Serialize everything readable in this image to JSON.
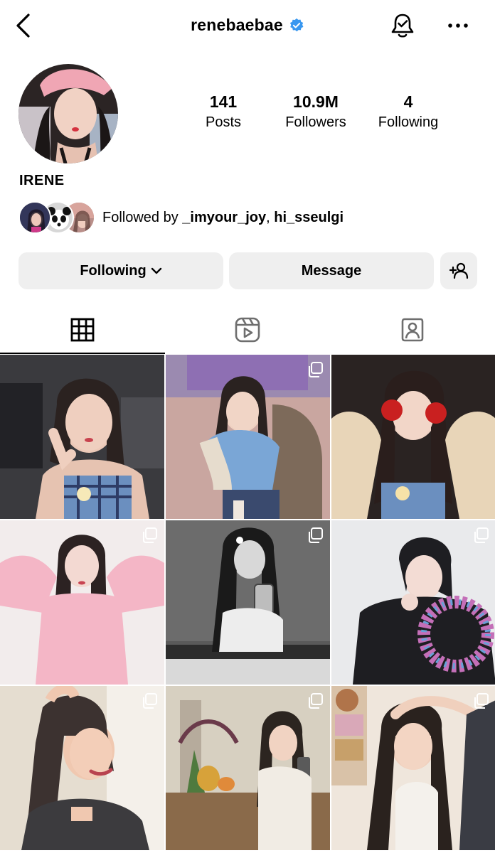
{
  "header": {
    "username": "renebaebae",
    "back_icon": "chevron-left-icon",
    "verified_icon": "verified-badge-icon",
    "verified_color": "#3897f0",
    "notification_icon": "bell-check-icon",
    "more_icon": "more-horizontal-icon"
  },
  "profile": {
    "display_name": "IRENE",
    "stats": [
      {
        "value": "141",
        "label": "Posts"
      },
      {
        "value": "10.9M",
        "label": "Followers"
      },
      {
        "value": "4",
        "label": "Following"
      }
    ],
    "followed_by_prefix": "Followed by ",
    "followed_by_user1": "_imyour_joy",
    "followed_by_sep": ", ",
    "followed_by_user2": "hi_sseulgi"
  },
  "actions": {
    "following_label": "Following",
    "message_label": "Message",
    "add_user_icon": "add-user-icon"
  },
  "tabs": [
    {
      "icon": "grid-icon",
      "active": true
    },
    {
      "icon": "reels-icon",
      "active": false
    },
    {
      "icon": "tagged-icon",
      "active": false
    }
  ],
  "posts": [
    {
      "multi": false,
      "colors": [
        "#3a3a3e",
        "#d8b8a8",
        "#6b8fbf"
      ]
    },
    {
      "multi": true,
      "colors": [
        "#8e6fb3",
        "#c9a6a0",
        "#7d6a5a"
      ]
    },
    {
      "multi": false,
      "colors": [
        "#2a2322",
        "#e8d2c4",
        "#c92020"
      ]
    },
    {
      "multi": true,
      "colors": [
        "#f4b6c6",
        "#f1d6cf",
        "#2c2222"
      ]
    },
    {
      "multi": true,
      "colors": [
        "#5a5a5a",
        "#d9d9d9",
        "#1a1a1a"
      ]
    },
    {
      "multi": true,
      "colors": [
        "#e9eaec",
        "#1e1e22",
        "#c46fb8"
      ]
    },
    {
      "multi": true,
      "colors": [
        "#e5ddd0",
        "#f0c8b0",
        "#3c3b3e"
      ]
    },
    {
      "multi": true,
      "colors": [
        "#d7d0c1",
        "#8a6a4a",
        "#2c2520"
      ]
    },
    {
      "multi": true,
      "colors": [
        "#efe6dc",
        "#f0d0bd",
        "#2a221e"
      ]
    }
  ]
}
